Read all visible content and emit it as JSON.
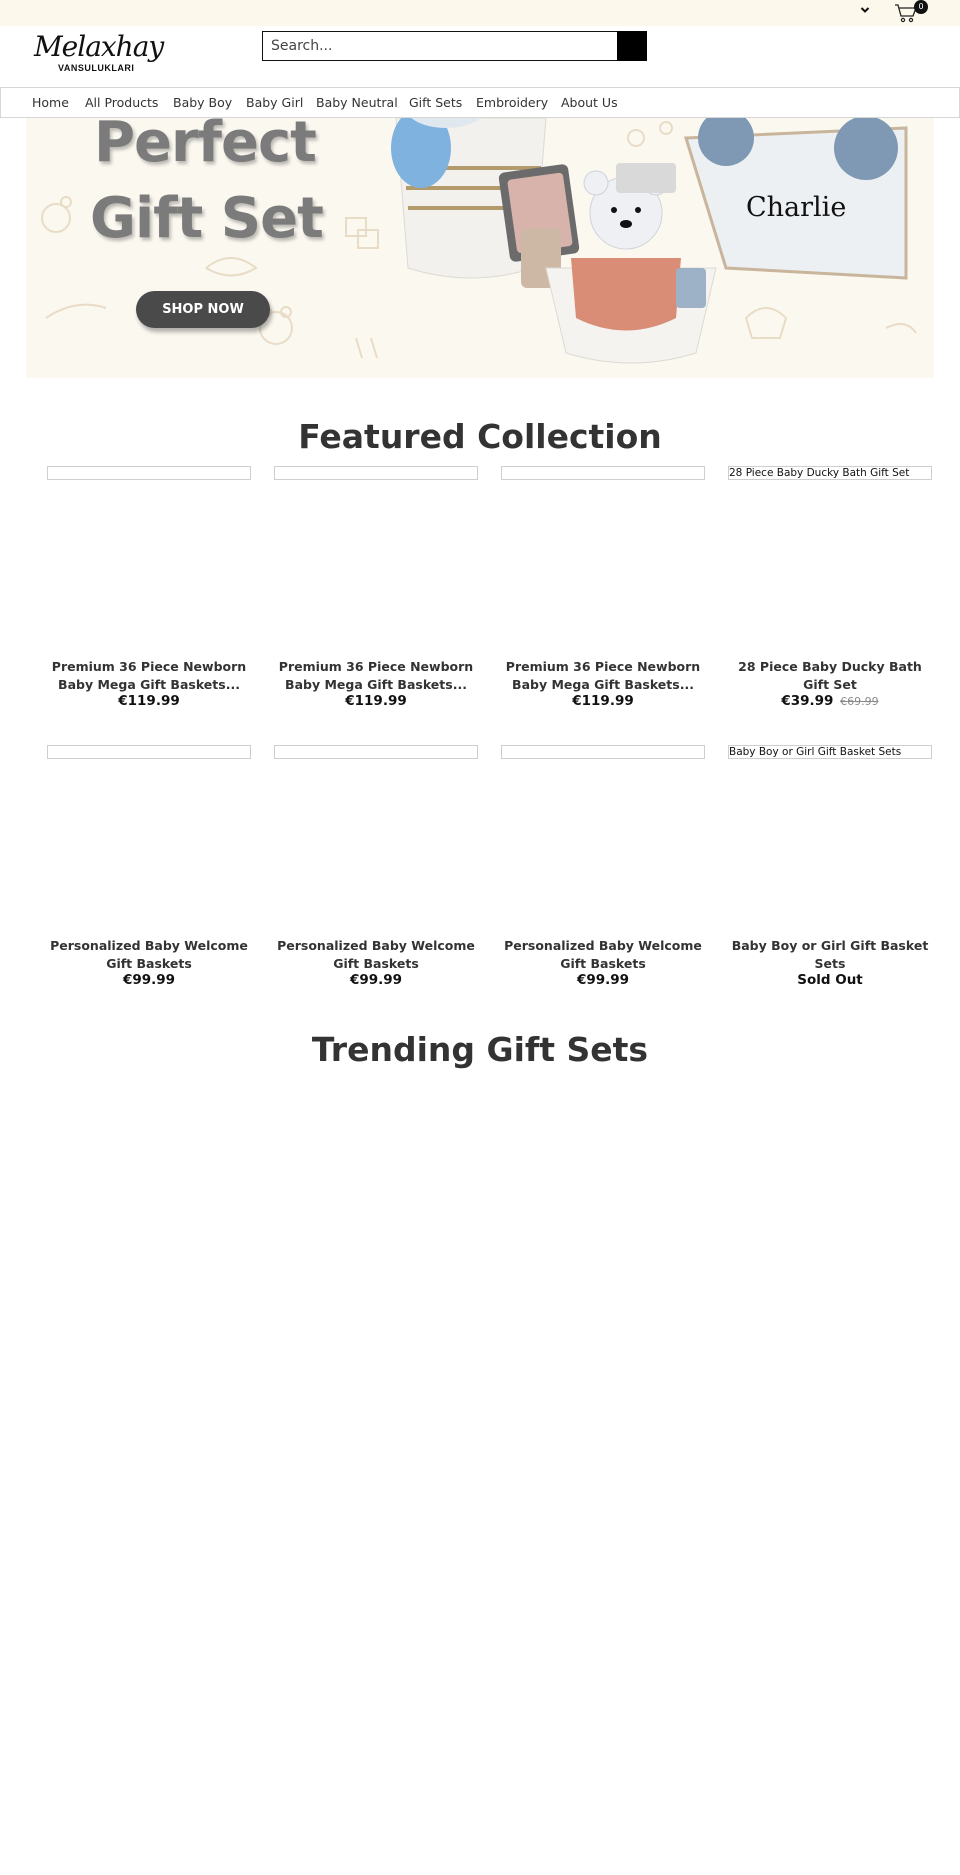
{
  "topbar": {
    "cart_count": "0"
  },
  "brand": {
    "name": "Melaxhay",
    "subtitle": "VANSULUKLARI"
  },
  "search": {
    "placeholder": "Search..."
  },
  "nav": {
    "items": [
      "Home",
      "All Products",
      "Baby Boy",
      "Baby Girl",
      "Baby Neutral",
      "Gift Sets",
      "Embroidery",
      "About Us"
    ]
  },
  "hero": {
    "title_line1": "Perfect",
    "title_line2": "Gift Set",
    "button_label": "SHOP NOW",
    "name_tag": "Charlie"
  },
  "featured": {
    "title": "Featured Collection",
    "products": [
      {
        "image_alt": "",
        "title": "Premium 36 Piece Newborn Baby Mega Gift Baskets...",
        "price": "€119.99",
        "compare_price": ""
      },
      {
        "image_alt": "",
        "title": "Premium 36 Piece Newborn Baby Mega Gift Baskets...",
        "price": "€119.99",
        "compare_price": ""
      },
      {
        "image_alt": "",
        "title": "Premium 36 Piece Newborn Baby Mega Gift Baskets...",
        "price": "€119.99",
        "compare_price": ""
      },
      {
        "image_alt": "28 Piece Baby Ducky Bath Gift Set",
        "title": "28 Piece Baby Ducky Bath Gift Set",
        "price": "€39.99",
        "compare_price": "€69.99"
      },
      {
        "image_alt": "",
        "title": "Personalized Baby Welcome Gift Baskets",
        "price": "€99.99",
        "compare_price": ""
      },
      {
        "image_alt": "",
        "title": "Personalized Baby Welcome Gift Baskets",
        "price": "€99.99",
        "compare_price": ""
      },
      {
        "image_alt": "",
        "title": "Personalized Baby Welcome Gift Baskets",
        "price": "€99.99",
        "compare_price": ""
      },
      {
        "image_alt": "Baby Boy or Girl Gift Basket Sets",
        "title": "Baby Boy or Girl Gift Basket Sets",
        "price": "Sold Out",
        "compare_price": ""
      }
    ]
  },
  "trending": {
    "title": "Trending Gift Sets"
  },
  "icons": {
    "dropdown": "chevron-down-icon",
    "cart": "cart-icon",
    "search": "search-icon"
  },
  "colors": {
    "topbar_bg": "#fcf8ec",
    "hero_bg": "#fbf8f0",
    "button_dark": "#4a4a4a",
    "text": "#333333"
  }
}
